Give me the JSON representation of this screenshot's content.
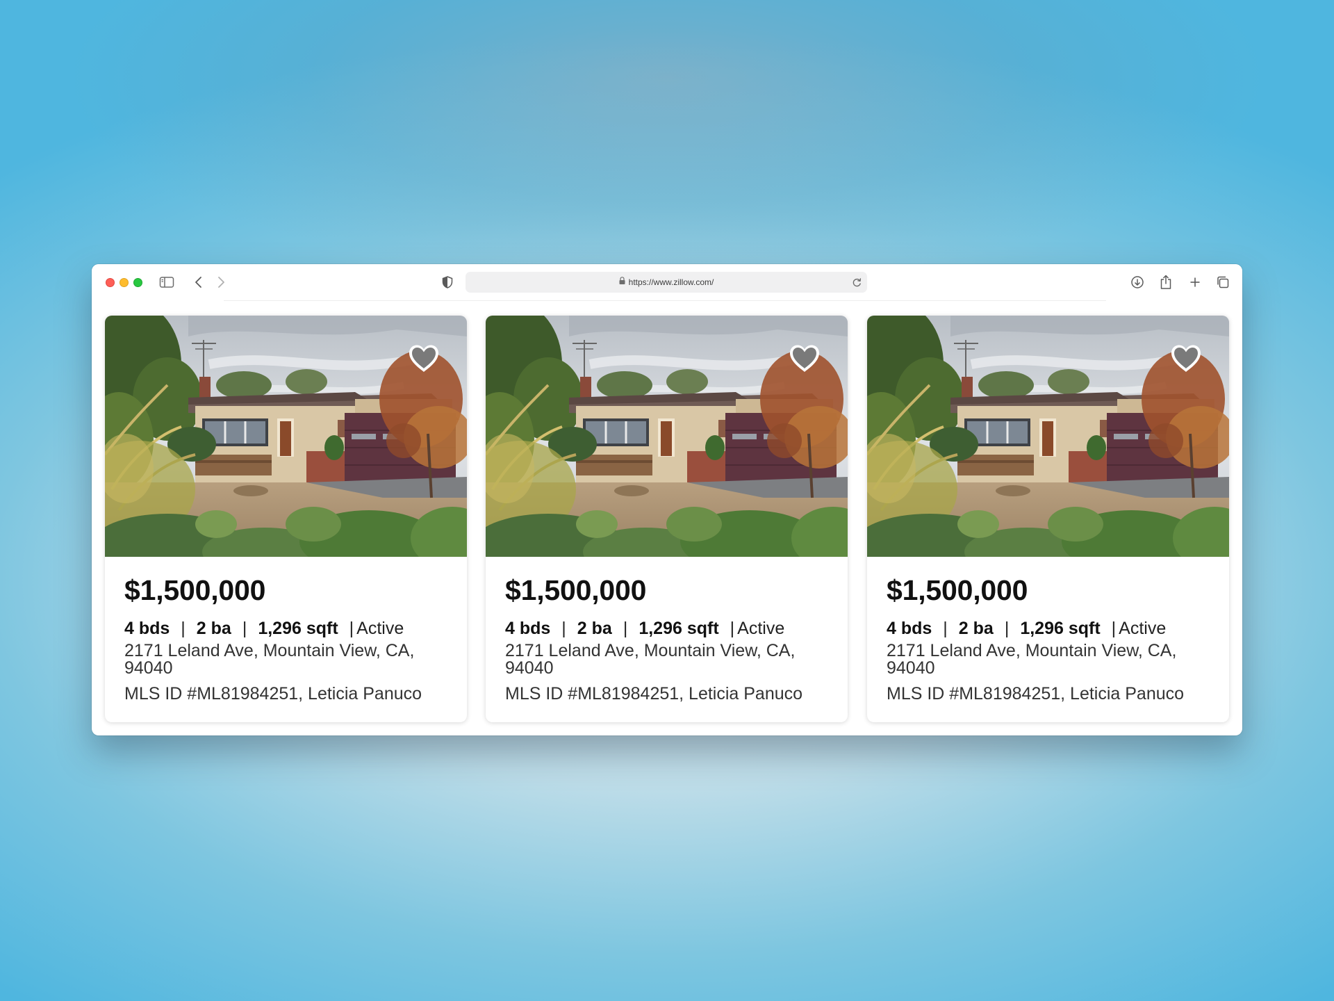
{
  "browser": {
    "url": "https://www.zillow.com/",
    "icons": [
      "sidebar-icon",
      "back-icon",
      "forward-icon",
      "privacy-shield-icon",
      "lock-icon",
      "reload-icon",
      "download-icon",
      "share-icon",
      "new-tab-icon",
      "tabs-overview-icon"
    ]
  },
  "listings": [
    {
      "price": "$1,500,000",
      "beds": "4 bds",
      "baths": "2 ba",
      "sqft": "1,296 sqft",
      "status": "Active",
      "address": "2171 Leland Ave, Mountain View, CA, 94040",
      "mls": "MLS ID #ML81984251, Leticia Panuco"
    },
    {
      "price": "$1,500,000",
      "beds": "4 bds",
      "baths": "2 ba",
      "sqft": "1,296 sqft",
      "status": "Active",
      "address": "2171 Leland Ave, Mountain View, CA, 94040",
      "mls": "MLS ID #ML81984251, Leticia Panuco"
    },
    {
      "price": "$1,500,000",
      "beds": "4 bds",
      "baths": "2 ba",
      "sqft": "1,296 sqft",
      "status": "Active",
      "address": "2171 Leland Ave, Mountain View, CA, 94040",
      "mls": "MLS ID #ML81984251, Leticia Panuco"
    }
  ],
  "colors": {
    "heart": "#7a7a7a",
    "garage_door": "#5e3440",
    "house_wall": "#d9c7a6"
  }
}
